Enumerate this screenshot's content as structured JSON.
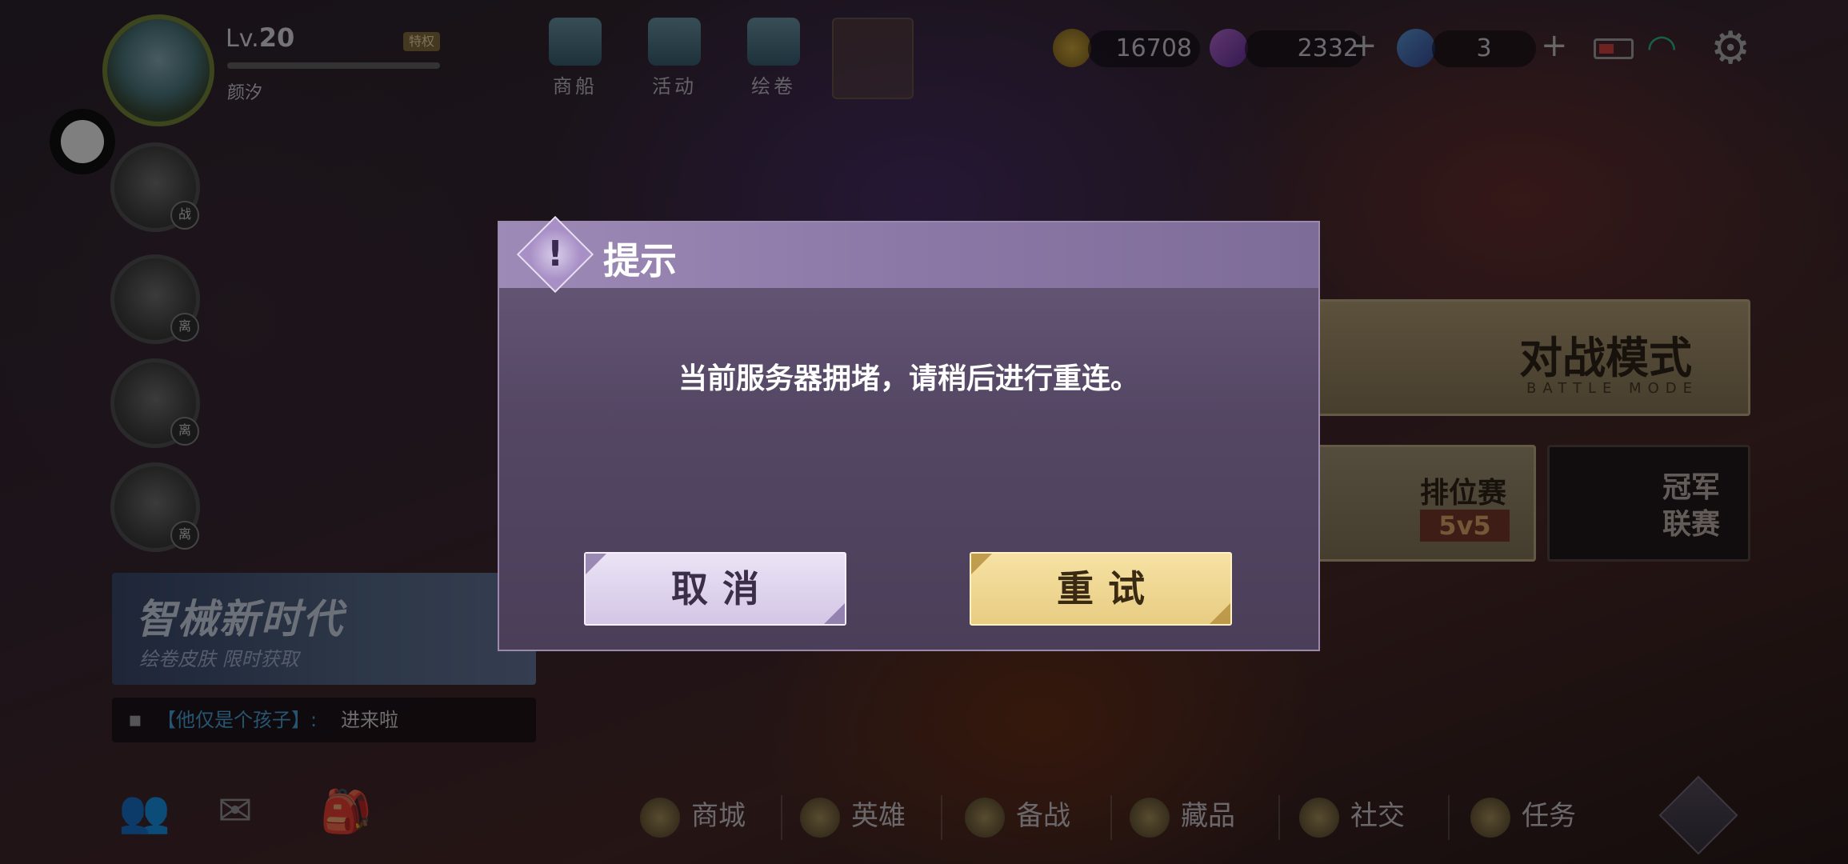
{
  "profile": {
    "level_prefix": "Lv.",
    "level": "20",
    "vip_badge": "特权",
    "name": "颜汐"
  },
  "top_menu": [
    {
      "label": "商船",
      "icon": "ship-icon"
    },
    {
      "label": "活动",
      "icon": "megaphone-icon"
    },
    {
      "label": "绘卷",
      "icon": "scroll-icon"
    }
  ],
  "resources": {
    "gold": "16708",
    "diamonds": "2332",
    "tokens": "3",
    "plus": "+"
  },
  "side_avatar_tags": [
    "战",
    "离",
    "离",
    "离"
  ],
  "modes": {
    "battle_cn": "对战模式",
    "battle_en": "BATTLE MODE",
    "ranked": "排位赛",
    "ranked_sub": "5v5",
    "champion": "冠军联赛"
  },
  "banner": {
    "title": "智械新时代",
    "subtitle": "绘卷皮肤 限时获取"
  },
  "chat": {
    "sender": "【他仅是个孩子】:",
    "message": "进来啦"
  },
  "bottom_nav": [
    "商城",
    "英雄",
    "备战",
    "藏品",
    "社交",
    "任务"
  ],
  "dialog": {
    "title": "提示",
    "message": "当前服务器拥堵，请稍后进行重连。",
    "cancel_label": "取消",
    "retry_label": "重试"
  },
  "colors": {
    "dialog_bg": "#544764",
    "cancel_bg": "#ddd2ec",
    "retry_bg": "#efd794",
    "wifi": "#2ec08a"
  }
}
